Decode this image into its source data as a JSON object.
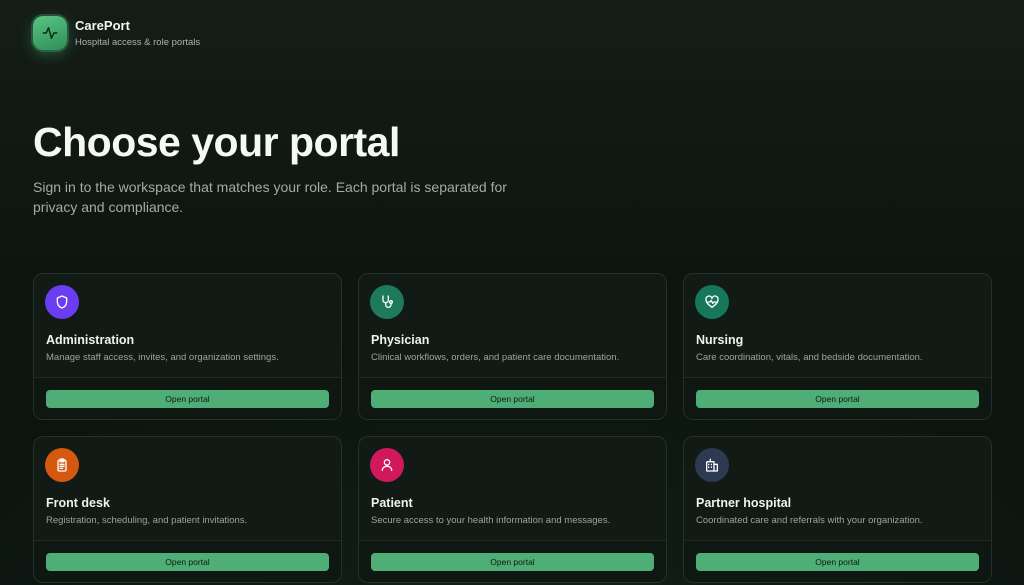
{
  "brand": {
    "name": "CarePort",
    "tagline": "Hospital access & role portals",
    "logo_icon": "activity-pulse-icon",
    "accent": "#4fae75"
  },
  "hero": {
    "title": "Choose your portal",
    "subtitle": "Sign in to the workspace that matches your role. Each portal is separated for privacy and compliance."
  },
  "portals": [
    {
      "title": "Administration",
      "description": "Manage staff access, invites, and organization settings.",
      "button": "Open portal",
      "icon": "shield-icon",
      "color": "#6a3df0"
    },
    {
      "title": "Physician",
      "description": "Clinical workflows, orders, and patient care documentation.",
      "button": "Open portal",
      "icon": "stethoscope-icon",
      "color": "#1d7a5c"
    },
    {
      "title": "Nursing",
      "description": "Care coordination, vitals, and bedside documentation.",
      "button": "Open portal",
      "icon": "heart-pulse-icon",
      "color": "#16775a"
    },
    {
      "title": "Front desk",
      "description": "Registration, scheduling, and patient invitations.",
      "button": "Open portal",
      "icon": "clipboard-icon",
      "color": "#d4580e"
    },
    {
      "title": "Patient",
      "description": "Secure access to your health information and messages.",
      "button": "Open portal",
      "icon": "user-icon",
      "color": "#d0185a"
    },
    {
      "title": "Partner hospital",
      "description": "Coordinated care and referrals with your organization.",
      "button": "Open portal",
      "icon": "hospital-building-icon",
      "color": "#2d3a52"
    }
  ]
}
